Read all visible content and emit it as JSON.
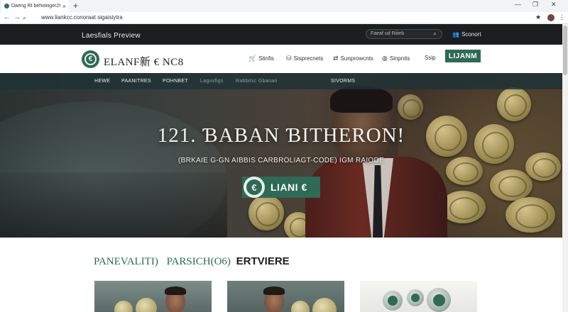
{
  "browser": {
    "tab_title": "Daeng Rt behiskiger2Obfie",
    "tab_close": "×",
    "new_tab": "+",
    "url": "www.liankcc.conoraat sigaisiytra",
    "controls": {
      "minimize": "—",
      "restore": "❐",
      "close": "✕",
      "back": "←",
      "forward": "→",
      "reload": "↻",
      "star": "★",
      "menu": "⋮"
    }
  },
  "topbar": {
    "preview": "Laesfials Preview",
    "search_placeholder": "Faeaf ud Riiieb",
    "support": "Sconort"
  },
  "header": {
    "brand": "ЕLANF新 € NC8",
    "nav": [
      {
        "label": "Stinfis",
        "icon": "cart-icon"
      },
      {
        "label": "Sisprecnets",
        "icon": "coins-icon"
      },
      {
        "label": "Sunprowcnts",
        "icon": "exchange-icon"
      },
      {
        "label": "Sinpnits",
        "icon": "globe-icon"
      },
      {
        "label": "Ssip",
        "icon": ""
      }
    ],
    "cta": "LIJANM"
  },
  "subnav": {
    "items": [
      "HEWE",
      "PAANITRES",
      "POHNBET",
      "Lagusfigs",
      "Rabbitsc Gbaoan",
      "SIVORMS"
    ]
  },
  "hero": {
    "title": "121. ƁABAN ƁITHERON!",
    "subtitle": "(BRKAIE G-GN AIBBIS CARBROLIAGT-CODE) IGM RAIODE",
    "button_label": "LIANI €"
  },
  "section": {
    "title_part1": "PANEVALITI)",
    "title_part2": "PARSICH(O6)",
    "title_part3": "ERTVIERE"
  },
  "colors": {
    "brand_green": "#2e6a55",
    "topbar_dark": "#1c1e1f",
    "subnav_teal": "#1e3237"
  }
}
